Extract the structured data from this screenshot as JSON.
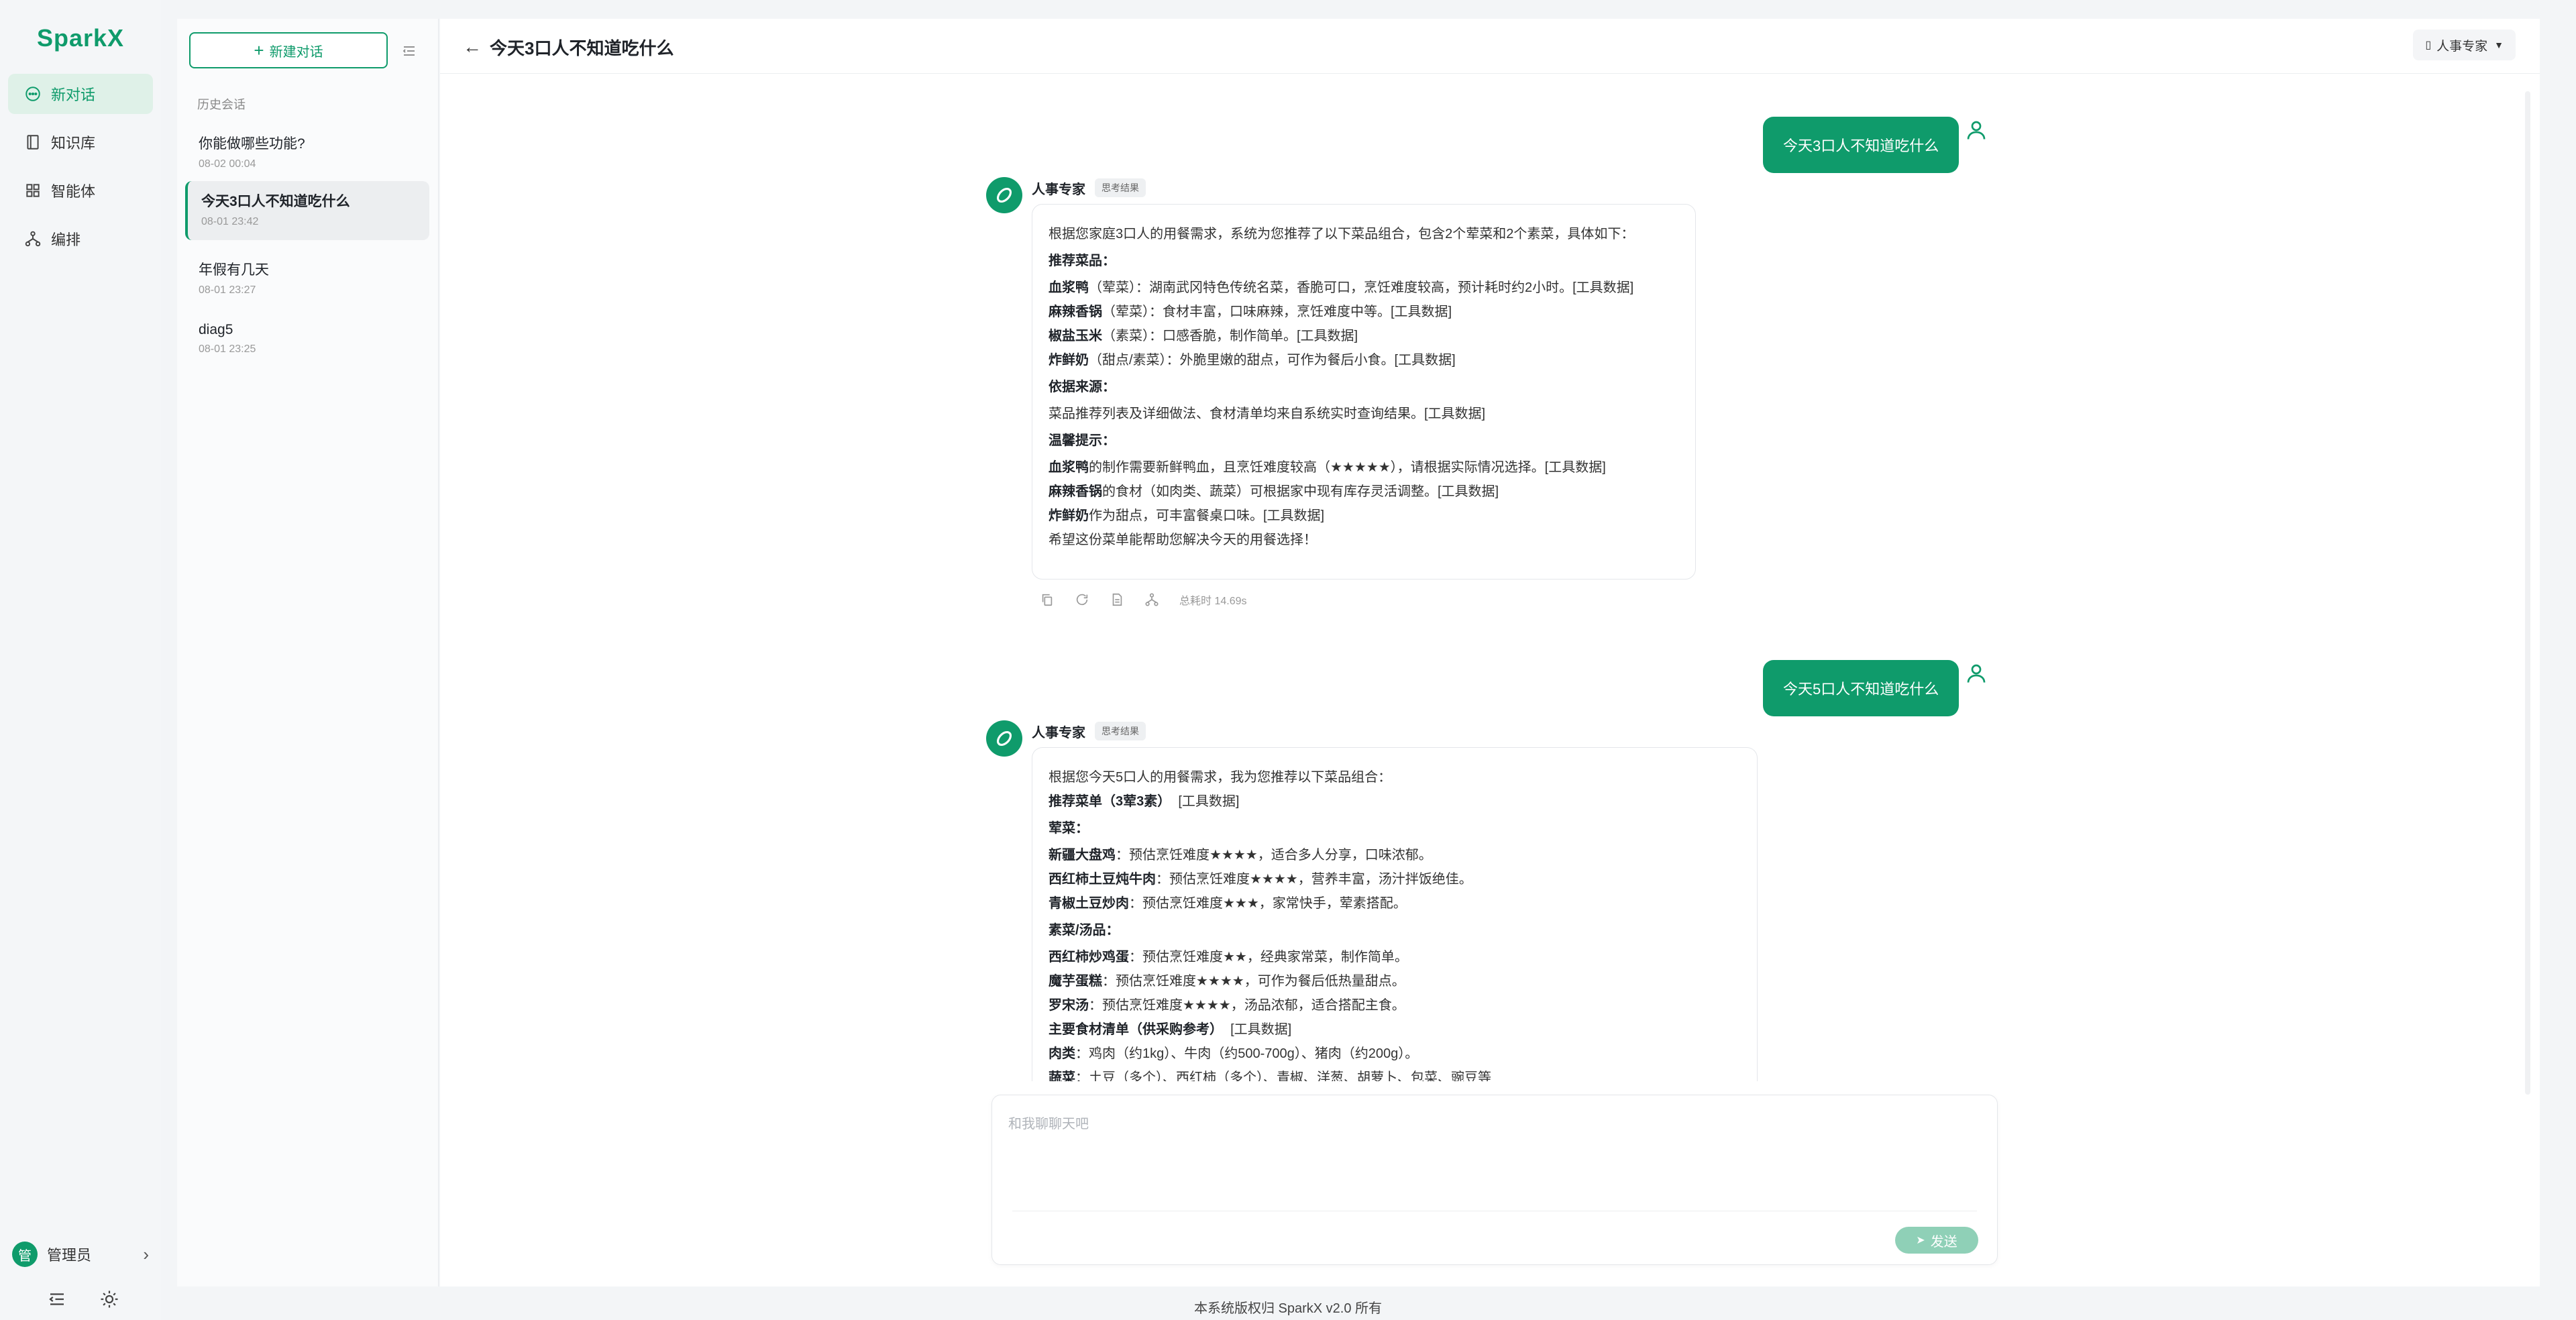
{
  "app": {
    "name": "SparkX"
  },
  "nav": {
    "items": [
      {
        "label": "新对话",
        "icon": "chat-icon"
      },
      {
        "label": "知识库",
        "icon": "book-icon"
      },
      {
        "label": "智能体",
        "icon": "grid-icon"
      },
      {
        "label": "编排",
        "icon": "flow-icon"
      }
    ],
    "user": {
      "avatar_char": "管",
      "name": "管理员"
    }
  },
  "sidebar": {
    "new_chat_label": "新建对话",
    "history_title": "历史会话",
    "items": [
      {
        "title": "你能做哪些功能?",
        "date": "08-02 00:04"
      },
      {
        "title": "今天3口人不知道吃什么",
        "date": "08-01 23:42"
      },
      {
        "title": "年假有几天",
        "date": "08-01 23:27"
      },
      {
        "title": "diag5",
        "date": "08-01 23:25"
      }
    ]
  },
  "header": {
    "title": "今天3口人不知道吃什么",
    "agent": "人事专家"
  },
  "chat": {
    "msg1": {
      "user": "今天3口人不知道吃什么"
    },
    "reply1": {
      "name": "人事专家",
      "tag": "思考结果",
      "intro": "根据您家庭3口人的用餐需求，系统为您推荐了以下菜品组合，包含2个荤菜和2个素菜，具体如下：",
      "h1": "推荐菜品：",
      "dishes": [
        {
          "name": "血浆鸭",
          "text": "（荤菜）：湖南武冈特色传统名菜，香脆可口，烹饪难度较高，预计耗时约2小时。[工具数据]"
        },
        {
          "name": "麻辣香锅",
          "text": "（荤菜）：食材丰富，口味麻辣，烹饪难度中等。[工具数据]"
        },
        {
          "name": "椒盐玉米",
          "text": "（素菜）：口感香脆，制作简单。[工具数据]"
        },
        {
          "name": "炸鲜奶",
          "text": "（甜点/素菜）：外脆里嫩的甜点，可作为餐后小食。[工具数据]"
        }
      ],
      "h2": "依据来源：",
      "source": "菜品推荐列表及详细做法、食材清单均来自系统实时查询结果。[工具数据]",
      "h3": "温馨提示：",
      "tips": [
        {
          "name": "血浆鸭",
          "text": "的制作需要新鲜鸭血，且烹饪难度较高（★★★★★），请根据实际情况选择。[工具数据]"
        },
        {
          "name": "麻辣香锅",
          "text": "的食材（如肉类、蔬菜）可根据家中现有库存灵活调整。[工具数据]"
        },
        {
          "name": "炸鲜奶",
          "text": "作为甜点，可丰富餐桌口味。[工具数据]"
        }
      ],
      "outro": "希望这份菜单能帮助您解决今天的用餐选择！",
      "elapsed": "总耗时 14.69s"
    },
    "msg2": {
      "user": "今天5口人不知道吃什么"
    },
    "reply2": {
      "name": "人事专家",
      "tag": "思考结果",
      "intro": "根据您今天5口人的用餐需求，我为您推荐以下菜品组合：",
      "menu_title": "推荐菜单（3荤3素）",
      "menu_tool": "[工具数据]",
      "meat_title": "荤菜：",
      "meat": [
        {
          "name": "新疆大盘鸡",
          "text": "：预估烹饪难度★★★★，适合多人分享，口味浓郁。"
        },
        {
          "name": "西红柿土豆炖牛肉",
          "text": "：预估烹饪难度★★★★，营养丰富，汤汁拌饭绝佳。"
        },
        {
          "name": "青椒土豆炒肉",
          "text": "：预估烹饪难度★★★，家常快手，荤素搭配。"
        }
      ],
      "veg_title": "素菜/汤品：",
      "veg": [
        {
          "name": "西红柿炒鸡蛋",
          "text": "：预估烹饪难度★★，经典家常菜，制作简单。"
        },
        {
          "name": "魔芋蛋糕",
          "text": "：预估烹饪难度★★★★，可作为餐后低热量甜点。"
        },
        {
          "name": "罗宋汤",
          "text": "：预估烹饪难度★★★★，汤品浓郁，适合搭配主食。"
        }
      ],
      "ingredients_title": "主要食材清单（供采购参考）",
      "ingredients_tool": "[工具数据]",
      "ing1_name": "肉类",
      "ing1_text": "：鸡肉（约1kg）、牛肉（约500-700g）、猪肉（约200g）。",
      "ing2_name": "蔬菜",
      "ing2_text": "：土豆（多个）、西红柿（多个）、青椒、洋葱、胡萝卜、包菜、豌豆等"
    }
  },
  "composer": {
    "placeholder": "和我聊聊天吧",
    "send_label": "发送"
  },
  "footer": {
    "text": "本系统版权归 SparkX v2.0 所有"
  },
  "colors": {
    "accent": "#0f9b6b",
    "accent_light": "#dff1e8",
    "send_disabled": "#8fd0b7"
  }
}
